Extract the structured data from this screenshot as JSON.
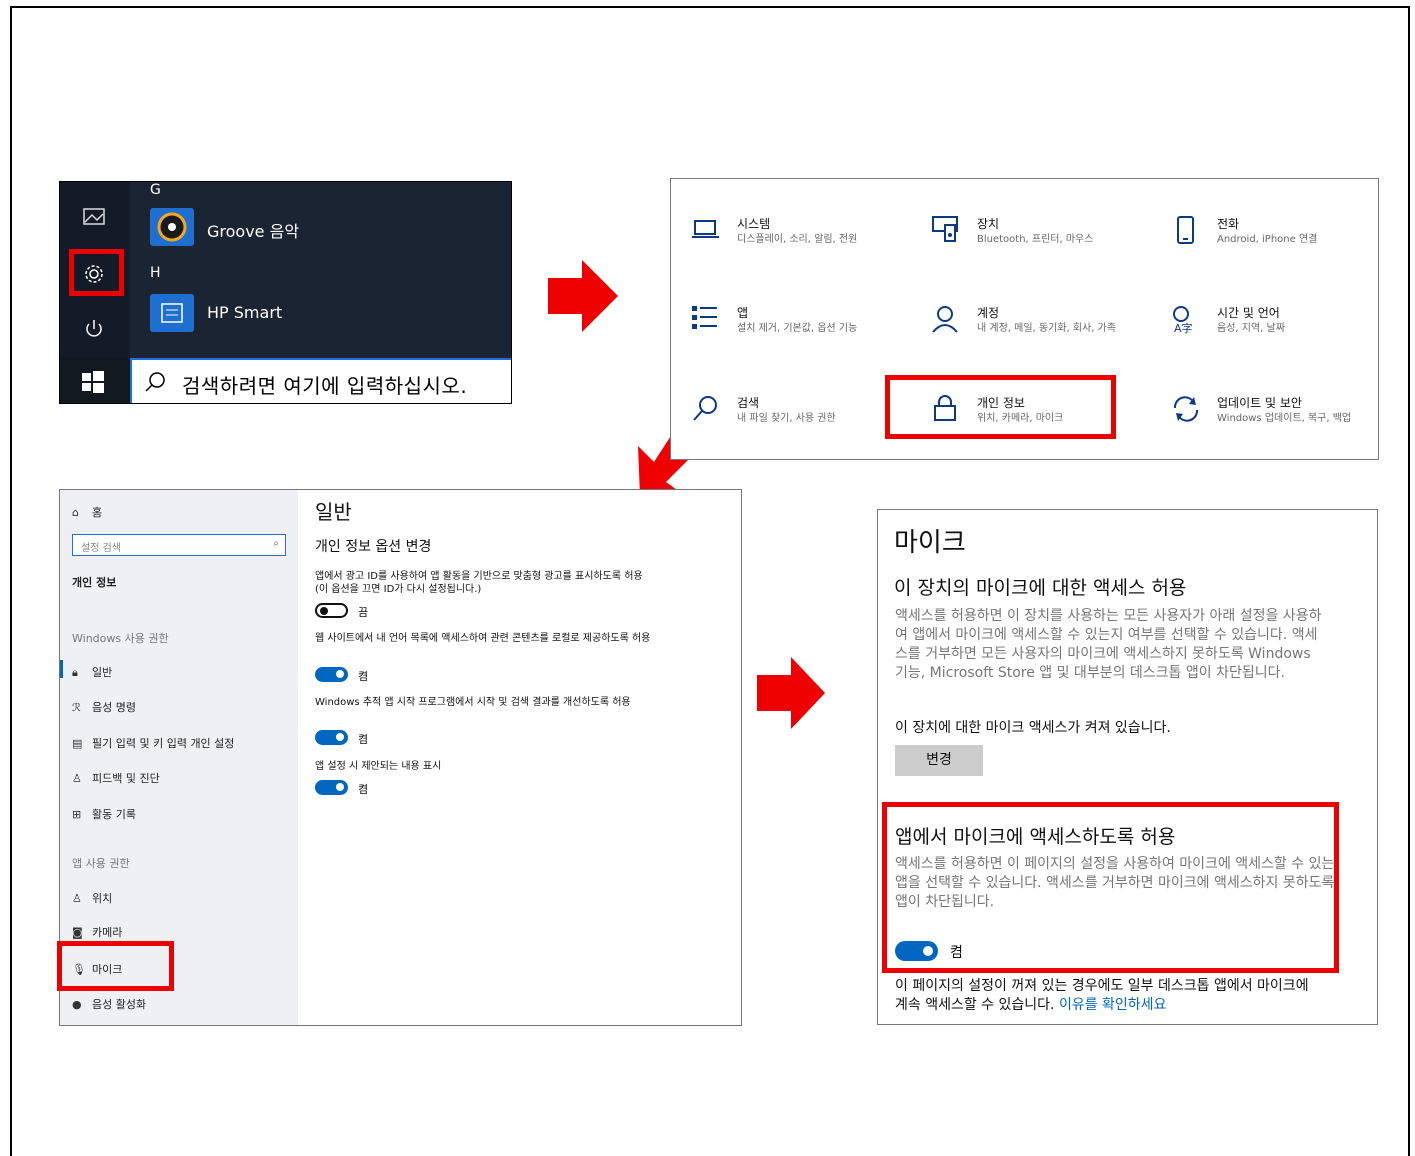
{
  "start_menu": {
    "letter_g": "G",
    "groove_label": "Groove 음악",
    "letter_h": "H",
    "hp_label": "HP Smart",
    "search_placeholder": "검색하려면 여기에 입력하십시오."
  },
  "settings_grid": [
    {
      "title": "시스템",
      "sub": "디스플레이, 소리, 알림, 전원",
      "icon": "laptop-icon"
    },
    {
      "title": "장치",
      "sub": "Bluetooth, 프린터, 마우스",
      "icon": "devices-icon"
    },
    {
      "title": "전화",
      "sub": "Android, iPhone 연결",
      "icon": "phone-icon"
    },
    {
      "title": "앱",
      "sub": "설치 제거, 기본값, 옵션 기능",
      "icon": "apps-icon"
    },
    {
      "title": "계정",
      "sub": "내 계정, 메일, 동기화, 회사, 가족",
      "icon": "person-icon"
    },
    {
      "title": "시간 및 언어",
      "sub": "음성, 지역, 날짜",
      "icon": "language-icon"
    },
    {
      "title": "검색",
      "sub": "내 파일 찾기, 사용 권한",
      "icon": "search-icon"
    },
    {
      "title": "개인 정보",
      "sub": "위치, 카메라, 마이크",
      "icon": "lock-icon"
    },
    {
      "title": "업데이트 및 보안",
      "sub": "Windows 업데이트, 복구, 백업",
      "icon": "sync-icon"
    }
  ],
  "privacy": {
    "home": "홈",
    "search_placeholder": "설정 검색",
    "section": "개인 정보",
    "win_perm": "Windows 사용 권한",
    "items": [
      "일반",
      "음성 명령",
      "필기 입력 및 키 입력 개인 설정",
      "피드백 및 진단",
      "활동 기록"
    ],
    "app_perm": "앱 사용 권한",
    "app_items": [
      "위치",
      "카메라",
      "마이크",
      "음성 활성화"
    ],
    "title": "일반",
    "subtitle": "개인 정보 옵션 변경",
    "opt1": "앱에서 광고 ID를 사용하여 앱 활동을 기반으로 맞춤형 광고를 표시하도록 허용(이 옵션을 끄면 ID가 다시 설정됩니다.)",
    "off": "끔",
    "opt2": "웹 사이트에서 내 언어 목록에 액세스하여 관련 콘텐츠를 로컬로 제공하도록 허용",
    "on": "켬",
    "opt3": "Windows 추적 앱 시작 프로그램에서 시작 및 검색 결과를 개선하도록 허용",
    "opt4": "앱 설정 시 제안되는 내용 표시"
  },
  "mic": {
    "title": "마이크",
    "h1": "이 장치의 마이크에 대한 액세스 허용",
    "p1": "액세스를 허용하면 이 장치를 사용하는 모든 사용자가 아래 설정을 사용하여 앱에서 마이크에 액세스할 수 있는지 여부를 선택할 수 있습니다. 액세스를 거부하면 모든 사용자의 마이크에 액세스하지 못하도록 Windows 기능, Microsoft Store 앱 및 대부분의 데스크톱 앱이 차단됩니다.",
    "status": "이 장치에 대한 마이크 액세스가 켜져 있습니다.",
    "change": "변경",
    "h2": "앱에서 마이크에 액세스하도록 허용",
    "p2": "액세스를 허용하면 이 페이지의 설정을 사용하여 마이크에 액세스할 수 있는 앱을 선택할 수 있습니다. 액세스를 거부하면 마이크에 액세스하지 못하도록 앱이 차단됩니다.",
    "on": "켬",
    "note": "이 페이지의 설정이 꺼져 있는 경우에도 일부 데스크톱 앱에서 마이크에 계속 액세스할 수 있습니다.",
    "link": "이유를 확인하세요"
  }
}
